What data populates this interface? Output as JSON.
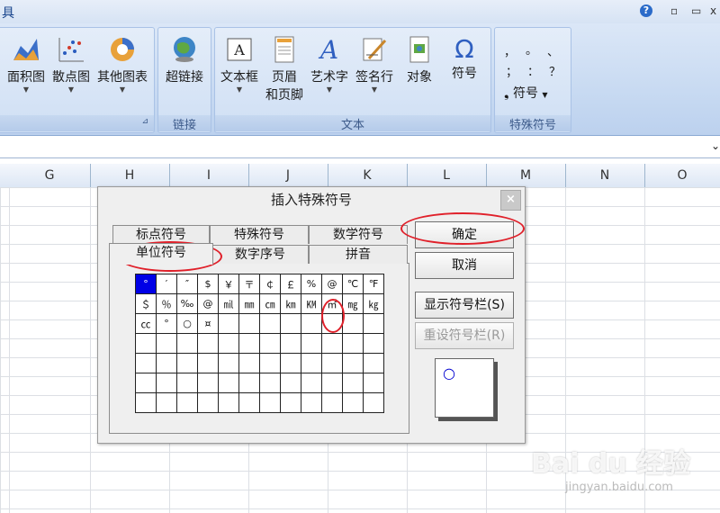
{
  "ribbon": {
    "tools_label": "具",
    "window_buttons": {
      "help": "?",
      "minimize": "▫",
      "close": "x"
    },
    "charts_group": {
      "items": [
        {
          "label": "面积图",
          "icon": "area-chart-icon"
        },
        {
          "label": "散点图",
          "icon": "scatter-chart-icon"
        },
        {
          "label": "其他图表",
          "icon": "other-chart-icon"
        }
      ]
    },
    "links_group": {
      "label": "链接",
      "items": [
        {
          "label": "超链接",
          "icon": "hyperlink-icon"
        }
      ]
    },
    "text_group": {
      "label": "文本",
      "items": [
        {
          "label": "文本框",
          "icon": "textbox-icon"
        },
        {
          "label": "页眉\n和页脚",
          "line1": "页眉",
          "line2": "和页脚",
          "icon": "header-footer-icon"
        },
        {
          "label": "艺术字",
          "icon": "wordart-icon"
        },
        {
          "label": "签名行",
          "icon": "signature-icon"
        },
        {
          "label": "对象",
          "icon": "object-icon"
        },
        {
          "label": "符号",
          "icon": "omega-icon"
        }
      ]
    },
    "special_group": {
      "label": "特殊符号",
      "symbols": [
        "，",
        "。",
        "、",
        "；",
        "：",
        "？"
      ],
      "symbol_button": "符号",
      "symbol_bullet": "❟"
    }
  },
  "columns": [
    "G",
    "H",
    "I",
    "J",
    "K",
    "L",
    "M",
    "N",
    "O"
  ],
  "dialog": {
    "title": "插入特殊符号",
    "close": "×",
    "tabs_back": [
      "标点符号",
      "特殊符号",
      "数学符号"
    ],
    "tabs_front": [
      "单位符号",
      "数字序号",
      "拼音"
    ],
    "symbols_rows": [
      [
        "°",
        "′",
        "″",
        "$",
        "￥",
        "〒",
        "￠",
        "￡",
        "%",
        "@",
        "℃",
        "℉"
      ],
      [
        "＄",
        "％",
        "‰",
        "@",
        "㏕",
        "㎜",
        "㎝",
        "㎞",
        "㏎",
        "㎡",
        "㎎",
        "㎏"
      ],
      [
        "㏄",
        "°",
        "○",
        "¤",
        "",
        "",
        "",
        "",
        "",
        "",
        "",
        ""
      ],
      [
        "",
        "",
        "",
        "",
        "",
        "",
        "",
        "",
        "",
        "",
        "",
        ""
      ],
      [
        "",
        "",
        "",
        "",
        "",
        "",
        "",
        "",
        "",
        "",
        "",
        ""
      ],
      [
        "",
        "",
        "",
        "",
        "",
        "",
        "",
        "",
        "",
        "",
        "",
        ""
      ],
      [
        "",
        "",
        "",
        "",
        "",
        "",
        "",
        "",
        "",
        "",
        "",
        ""
      ]
    ],
    "buttons": {
      "ok": "确定",
      "cancel": "取消",
      "show_bar": "显示符号栏(S)",
      "reset_bar": "重设符号栏(R)"
    },
    "preview_char": "○"
  },
  "watermark": {
    "brand": "Bai du 经验",
    "url": "jingyan.baidu.com"
  },
  "colors": {
    "annotation": "#e0202a",
    "selection": "#0000e6",
    "ribbon": "#c5d8f1"
  }
}
